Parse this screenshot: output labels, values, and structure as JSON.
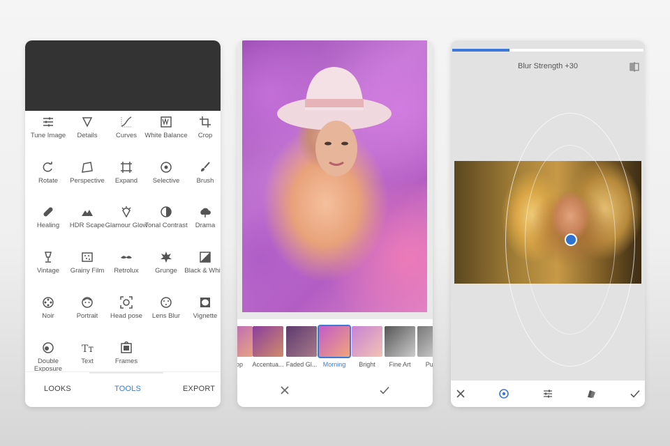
{
  "panel_tools": {
    "tools": [
      {
        "label": "Tune Image",
        "icon": "tune-icon"
      },
      {
        "label": "Details",
        "icon": "details-icon"
      },
      {
        "label": "Curves",
        "icon": "curves-icon"
      },
      {
        "label": "White Balance",
        "icon": "white-balance-icon"
      },
      {
        "label": "Crop",
        "icon": "crop-icon"
      },
      {
        "label": "Rotate",
        "icon": "rotate-icon"
      },
      {
        "label": "Perspective",
        "icon": "perspective-icon"
      },
      {
        "label": "Expand",
        "icon": "expand-icon"
      },
      {
        "label": "Selective",
        "icon": "selective-icon"
      },
      {
        "label": "Brush",
        "icon": "brush-icon"
      },
      {
        "label": "Healing",
        "icon": "healing-icon"
      },
      {
        "label": "HDR Scape",
        "icon": "hdr-icon"
      },
      {
        "label": "Glamour Glow",
        "icon": "glamour-glow-icon"
      },
      {
        "label": "Tonal Contrast",
        "icon": "tonal-contrast-icon"
      },
      {
        "label": "Drama",
        "icon": "drama-icon"
      },
      {
        "label": "Vintage",
        "icon": "vintage-icon"
      },
      {
        "label": "Grainy Film",
        "icon": "grainy-film-icon"
      },
      {
        "label": "Retrolux",
        "icon": "retrolux-icon"
      },
      {
        "label": "Grunge",
        "icon": "grunge-icon"
      },
      {
        "label": "Black & White",
        "icon": "black-white-icon"
      },
      {
        "label": "Noir",
        "icon": "noir-icon"
      },
      {
        "label": "Portrait",
        "icon": "portrait-icon"
      },
      {
        "label": "Head pose",
        "icon": "head-pose-icon"
      },
      {
        "label": "Lens Blur",
        "icon": "lens-blur-icon"
      },
      {
        "label": "Vignette",
        "icon": "vignette-icon"
      },
      {
        "label": "Double Exposure",
        "icon": "double-exposure-icon"
      },
      {
        "label": "Text",
        "icon": "text-icon"
      },
      {
        "label": "Frames",
        "icon": "frames-icon"
      }
    ],
    "nav": {
      "looks": "LOOKS",
      "tools": "TOOLS",
      "export": "EXPORT",
      "active": "TOOLS"
    }
  },
  "panel_looks": {
    "looks": [
      {
        "label": "Pop"
      },
      {
        "label": "Accentua..."
      },
      {
        "label": "Faded Gl..."
      },
      {
        "label": "Morning",
        "active": true
      },
      {
        "label": "Bright"
      },
      {
        "label": "Fine Art"
      },
      {
        "label": "Push"
      }
    ],
    "cancel_icon": "close-icon",
    "apply_icon": "check-icon"
  },
  "panel_blur": {
    "title": "Blur Strength +30",
    "blur_strength": 30,
    "progress_fraction": 0.3,
    "toolbar_icons": [
      "close-icon",
      "target-icon",
      "sliders-icon",
      "style-icon",
      "check-icon"
    ]
  },
  "colors": {
    "accent": "#3b78d8",
    "dark_header": "#333333"
  }
}
